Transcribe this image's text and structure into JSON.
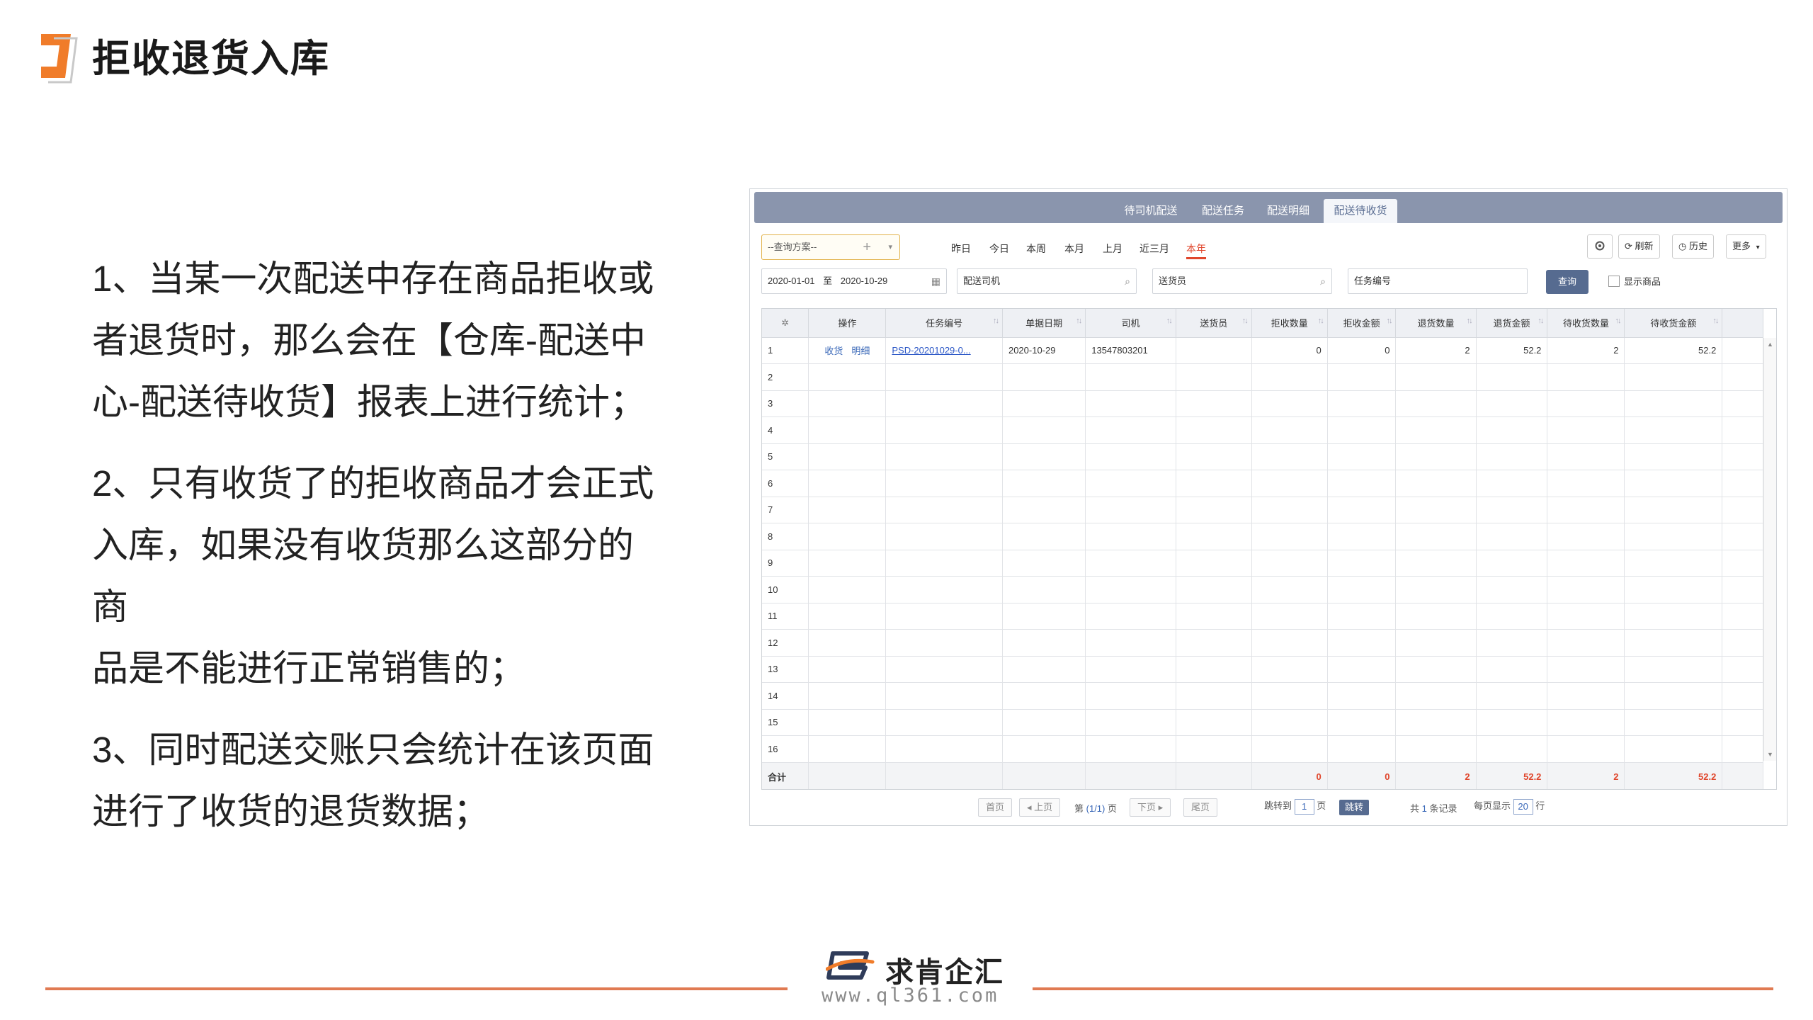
{
  "slide": {
    "title": "拒收退货入库",
    "bullets": [
      {
        "lines": [
          "1、当某一次配送中存在商品拒收或",
          "者退货时，那么会在【仓库-配送中",
          "心-配送待收货】报表上进行统计；"
        ]
      },
      {
        "lines": [
          "2、只有收货了的拒收商品才会正式",
          "入库，如果没有收货那么这部分的商",
          "品是不能进行正常销售的；"
        ]
      },
      {
        "lines": [
          "3、同时配送交账只会统计在该页面",
          "进行了收货的退货数据；"
        ]
      }
    ],
    "colors": {
      "accent": "#e07a52",
      "logo_orange": "#f07c2a"
    }
  },
  "app": {
    "tabs": [
      "待司机配送",
      "配送任务",
      "配送明细",
      "配送待收货"
    ],
    "active_tab": "配送待收货",
    "scheme": {
      "placeholder": "--查询方案--",
      "plus": "+",
      "caret": "▾"
    },
    "periods": [
      "昨日",
      "今日",
      "本周",
      "本月",
      "上月",
      "近三月",
      "本年"
    ],
    "active_period": "本年",
    "tools": {
      "settings_icon": "gear-icon",
      "refresh": "刷新",
      "history": "历史",
      "more": "更多"
    },
    "filters": {
      "date_from": "2020-01-01",
      "date_sep": "至",
      "date_to": "2020-10-29",
      "driver": "配送司机",
      "sender": "送货员",
      "task_no": "任务编号",
      "query": "查询",
      "show_goods": "显示商品"
    },
    "table": {
      "headers": [
        "",
        "操作",
        "任务编号",
        "单据日期",
        "司机",
        "送货员",
        "拒收数量",
        "拒收金额",
        "退货数量",
        "退货金额",
        "待收货数量",
        "待收货金额"
      ],
      "row1": {
        "idx": "1",
        "op_receive": "收货",
        "op_detail": "明细",
        "task_no": "PSD-20201029-0...",
        "date": "2020-10-29",
        "driver": "13547803201",
        "sender": "",
        "reject_qty": "0",
        "reject_amt": "0",
        "return_qty": "2",
        "return_amt": "52.2",
        "pending_qty": "2",
        "pending_amt": "52.2"
      },
      "empty_row_numbers": [
        "2",
        "3",
        "4",
        "5",
        "6",
        "7",
        "8",
        "9",
        "10",
        "11",
        "12",
        "13",
        "14",
        "15",
        "16"
      ],
      "total": {
        "label": "合计",
        "reject_qty": "0",
        "reject_amt": "0",
        "return_qty": "2",
        "return_amt": "52.2",
        "pending_qty": "2",
        "pending_amt": "52.2"
      }
    },
    "pager": {
      "first": "首页",
      "prev": "◂ 上页",
      "page_prefix": "第",
      "page_info": "(1/1)",
      "page_suffix": "页",
      "next": "下页 ▸",
      "last": "尾页",
      "jump_to": "跳转到",
      "jump_page": "1",
      "page_unit": "页",
      "jump": "跳转",
      "total_prefix": "共",
      "total_count": "1",
      "total_suffix": "条记录",
      "per_page_prefix": "每页显示",
      "per_page": "20",
      "per_page_suffix": "行"
    }
  },
  "brand": {
    "name": "求肯企汇",
    "url": "www.ql361.com"
  }
}
